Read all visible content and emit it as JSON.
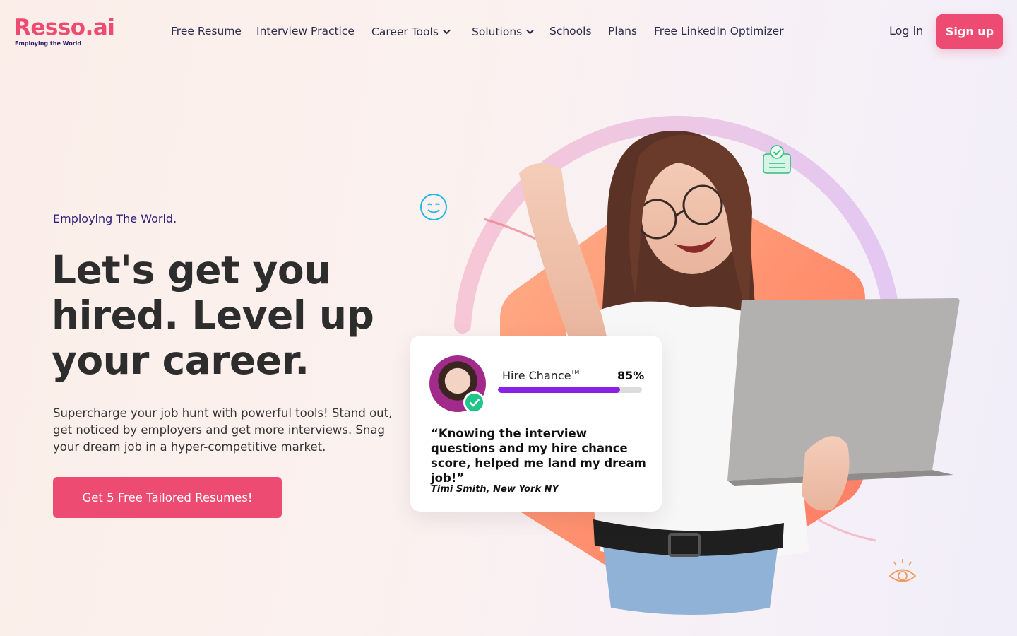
{
  "brand": {
    "name": "Resso.ai",
    "tagline": "Employing the World",
    "color": "#ee4b73"
  },
  "nav": {
    "links": [
      {
        "label": "Free Resume"
      },
      {
        "label": "Interview Practice"
      },
      {
        "label": "Career Tools",
        "dropdown": true
      },
      {
        "label": "Solutions",
        "dropdown": true
      },
      {
        "label": "Schools"
      },
      {
        "label": "Plans"
      },
      {
        "label": "Free LinkedIn Optimizer"
      }
    ],
    "login_label": "Log in",
    "signup_label": "Sign up"
  },
  "hero": {
    "eyebrow": "Employing The World.",
    "headline": "Let's get you hired. Level up your career.",
    "subcopy": "Supercharge your job hunt with powerful tools! Stand out, get noticed by employers and get more interviews. Snag your dream job in a hyper-competitive market.",
    "cta_label": "Get 5 Free Tailored Resumes!"
  },
  "testimonial": {
    "metric_label": "Hire Chance",
    "metric_mark": "TM",
    "metric_value": "85%",
    "metric_fraction": 0.85,
    "quote": "“Knowing the interview questions and my hire chance score, helped me land my dream job!”",
    "author": "Timi Smith, New York NY"
  },
  "icons": [
    "smile-icon",
    "clipboard-check-icon",
    "eye-icon",
    "check-icon",
    "chevron-down-icon"
  ],
  "colors": {
    "accent": "#ee4b73",
    "progress": "#8a22e6",
    "verified": "#20c58a",
    "heading": "#2d2d2d",
    "eyebrow": "#2e1f7a"
  }
}
